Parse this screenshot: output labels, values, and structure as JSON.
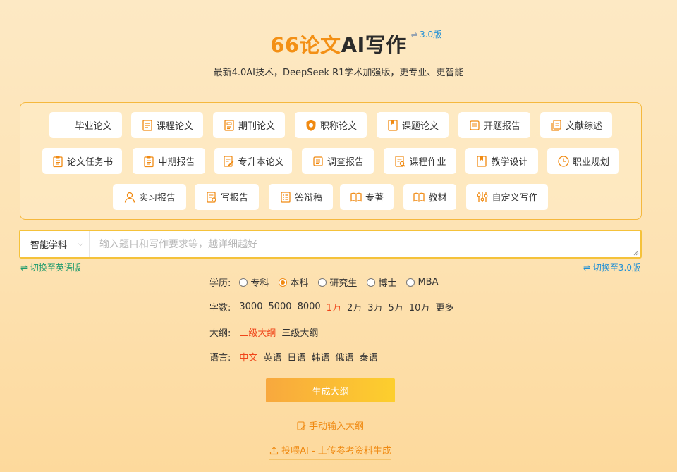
{
  "header": {
    "brand": "66论文",
    "title_rest": "AI写作",
    "version_link": "3.0版",
    "subtitle": "最新4.0AI技术，DeepSeek R1学术加强版，更专业、更智能"
  },
  "paper_types": [
    {
      "label": "毕业论文",
      "icon": "graduation-cap-icon",
      "active": true
    },
    {
      "label": "课程论文",
      "icon": "document-icon"
    },
    {
      "label": "期刊论文",
      "icon": "journal-icon"
    },
    {
      "label": "职称论文",
      "icon": "badge-icon"
    },
    {
      "label": "课题论文",
      "icon": "bookmark-icon"
    },
    {
      "label": "开题报告",
      "icon": "report-icon"
    },
    {
      "label": "文献综述",
      "icon": "documents-icon"
    },
    {
      "label": "论文任务书",
      "icon": "clipboard-icon"
    },
    {
      "label": "中期报告",
      "icon": "clipboard-icon"
    },
    {
      "label": "专升本论文",
      "icon": "edit-document-icon"
    },
    {
      "label": "调查报告",
      "icon": "survey-icon"
    },
    {
      "label": "课程作业",
      "icon": "search-document-icon"
    },
    {
      "label": "教学设计",
      "icon": "bookmark-icon"
    },
    {
      "label": "职业规划",
      "icon": "clock-icon"
    },
    {
      "label": "实习报告",
      "icon": "user-icon"
    },
    {
      "label": "写报告",
      "icon": "write-document-icon"
    },
    {
      "label": "答辩稿",
      "icon": "list-document-icon"
    },
    {
      "label": "专著",
      "icon": "book-icon"
    },
    {
      "label": "教材",
      "icon": "book-icon"
    },
    {
      "label": "自定义写作",
      "icon": "sliders-icon"
    }
  ],
  "prompt": {
    "subject_select": "智能学科",
    "placeholder": "输入题目和写作要求等，越详细越好"
  },
  "switch_english": "⇌ 切换至英语版",
  "switch_v3": "⇌ 切换至3.0版",
  "options": {
    "education": {
      "label": "学历:",
      "items": [
        "专科",
        "本科",
        "研究生",
        "博士",
        "MBA"
      ],
      "selected": "本科"
    },
    "word_count": {
      "label": "字数:",
      "items": [
        "3000",
        "5000",
        "8000",
        "1万",
        "2万",
        "3万",
        "5万",
        "10万",
        "更多"
      ],
      "selected": "1万"
    },
    "outline": {
      "label": "大纲:",
      "items": [
        "二级大纲",
        "三级大纲"
      ],
      "selected": "二级大纲"
    },
    "language": {
      "label": "语言:",
      "items": [
        "中文",
        "英语",
        "日语",
        "韩语",
        "俄语",
        "泰语"
      ],
      "selected": "中文"
    }
  },
  "generate_button": "生成大纲",
  "manual_outline_link": "手动输入大纲",
  "upload_link": "投喂AI - 上传参考资料生成",
  "colors": {
    "accent": "#f08a12",
    "selected_text": "#f0461a",
    "panel_border": "#f5b83d",
    "link_blue": "#1e8fd6",
    "link_green": "#1d9a6c"
  }
}
